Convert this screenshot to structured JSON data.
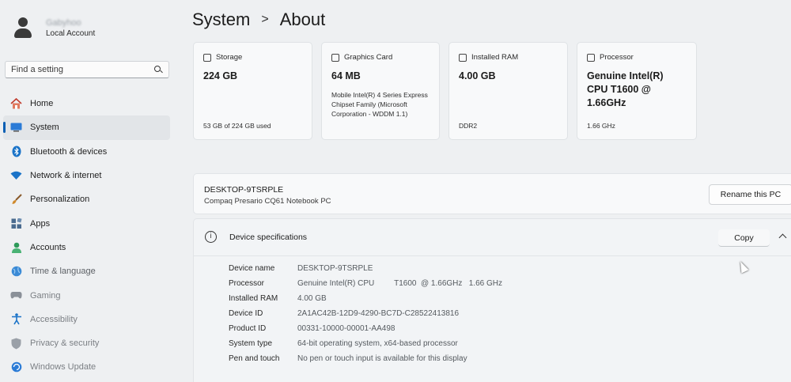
{
  "account": {
    "name": "Gabyhoo",
    "type": "Local Account"
  },
  "search": {
    "placeholder": "Find a setting"
  },
  "nav": {
    "items": [
      {
        "label": "Home",
        "icon": "home-icon",
        "color": "#c0392b"
      },
      {
        "label": "System",
        "icon": "system-icon",
        "color": "#0a5fb4"
      },
      {
        "label": "Bluetooth & devices",
        "icon": "bluetooth-icon",
        "color": "#1a73c8"
      },
      {
        "label": "Network & internet",
        "icon": "wifi-icon",
        "color": "#1a73c8"
      },
      {
        "label": "Personalization",
        "icon": "brush-icon",
        "color": "#d08a2c"
      },
      {
        "label": "Apps",
        "icon": "apps-icon",
        "color": "#4a5f7a"
      },
      {
        "label": "Accounts",
        "icon": "accounts-icon",
        "color": "#2e9a5a"
      },
      {
        "label": "Time & language",
        "icon": "globe-icon",
        "color": "#1a73c8"
      },
      {
        "label": "Gaming",
        "icon": "gamepad-icon",
        "color": "#7a8088"
      },
      {
        "label": "Accessibility",
        "icon": "accessibility-icon",
        "color": "#1a73c8"
      },
      {
        "label": "Privacy & security",
        "icon": "shield-icon",
        "color": "#7a8088"
      },
      {
        "label": "Windows Update",
        "icon": "update-icon",
        "color": "#1a73c8"
      }
    ],
    "active_index": 1
  },
  "breadcrumb": {
    "parent": "System",
    "separator": ">",
    "current": "About"
  },
  "cards": {
    "storage": {
      "title": "Storage",
      "value": "224 GB",
      "footer": "53 GB of 224 GB used"
    },
    "graphics": {
      "title": "Graphics Card",
      "value": "64 MB",
      "desc": "Mobile Intel(R) 4 Series Express Chipset Family (Microsoft Corporation - WDDM 1.1)"
    },
    "ram": {
      "title": "Installed RAM",
      "value": "4.00 GB",
      "footer": "DDR2"
    },
    "processor": {
      "title": "Processor",
      "value": "Genuine Intel(R) CPU T1600  @ 1.66GHz",
      "footer": "1.66 GHz"
    }
  },
  "device": {
    "name": "DESKTOP-9TSRPLE",
    "model": "Compaq Presario CQ61 Notebook PC",
    "rename_label": "Rename this PC"
  },
  "specs": {
    "title": "Device specifications",
    "copy_label": "Copy",
    "rows": [
      {
        "key": "Device name",
        "value": "DESKTOP-9TSRPLE"
      },
      {
        "key": "Processor",
        "value": "Genuine Intel(R) CPU         T1600  @ 1.66GHz   1.66 GHz"
      },
      {
        "key": "Installed RAM",
        "value": "4.00 GB"
      },
      {
        "key": "Device ID",
        "value": "2A1AC42B-12D9-4290-BC7D-C28522413816"
      },
      {
        "key": "Product ID",
        "value": "00331-10000-00001-AA498"
      },
      {
        "key": "System type",
        "value": "64-bit operating system, x64-based processor"
      },
      {
        "key": "Pen and touch",
        "value": "No pen or touch input is available for this display"
      }
    ]
  }
}
